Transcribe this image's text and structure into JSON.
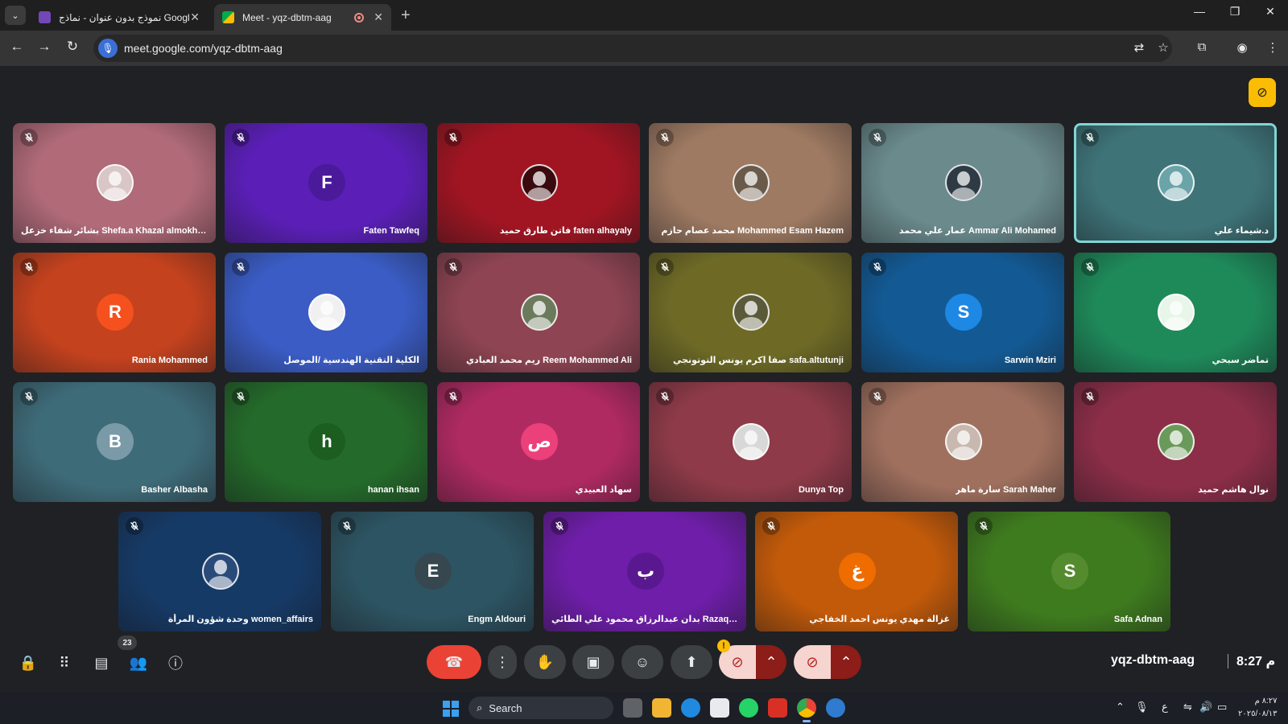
{
  "browser": {
    "tabs": [
      {
        "title": "نموذج بدون عنوان - نماذج Google",
        "active": false
      },
      {
        "title": "Meet - yqz-dbtm-aag",
        "active": true
      }
    ],
    "url": "meet.google.com/yqz-dbtm-aag"
  },
  "meet": {
    "participants": [
      {
        "name": "بشائر شفاء خزعل Shefa.a Khazal almokhtar ...",
        "initial": "",
        "bg": "#b06a78",
        "avatar_color": "#d9c6c6",
        "photo": true
      },
      {
        "name": "Faten Tawfeq",
        "initial": "F",
        "bg": "#5b1fb8",
        "avatar_color": "#4a1a9a",
        "photo": false
      },
      {
        "name": "فاتن طارق حميد faten alhayaly",
        "initial": "",
        "bg": "#a11522",
        "avatar_color": "#3a0a0e",
        "photo": true
      },
      {
        "name": "محمد عصام حازم Mohammed Esam Hazem",
        "initial": "",
        "bg": "#9e7a62",
        "avatar_color": "#6a5a4a",
        "photo": true
      },
      {
        "name": "عمار علي محمد Ammar Ali Mohamed",
        "initial": "",
        "bg": "#6a8a8c",
        "avatar_color": "#2e3a44",
        "photo": true
      },
      {
        "name": "د.شيماء علي",
        "initial": "",
        "bg": "#3e7478",
        "avatar_color": "#6aa4a8",
        "photo": true
      },
      {
        "name": "Rania Mohammed",
        "initial": "R",
        "bg": "#c4421e",
        "avatar_color": "#f4511e",
        "photo": false
      },
      {
        "name": "الكلية التقنية الهندسية /الموصل",
        "initial": "",
        "bg": "#3a5cc4",
        "avatar_color": "#f0f0f0",
        "photo": true
      },
      {
        "name": "ريم محمد العبادي Reem Mohammed Ali",
        "initial": "",
        "bg": "#8e4452",
        "avatar_color": "#6a7a5a",
        "photo": true
      },
      {
        "name": "صفا اكرم يونس التوتونجي safa.altutunji",
        "initial": "",
        "bg": "#6e6a26",
        "avatar_color": "#5a5a3a",
        "photo": true
      },
      {
        "name": "Sarwin Mziri",
        "initial": "S",
        "bg": "#135a94",
        "avatar_color": "#1e88e5",
        "photo": false
      },
      {
        "name": "تماضر سبحي",
        "initial": "",
        "bg": "#1e8a5a",
        "avatar_color": "#e8f5e9",
        "photo": true
      },
      {
        "name": "Basher Albasha",
        "initial": "B",
        "bg": "#3e6b78",
        "avatar_color": "#7b9aa8",
        "photo": false
      },
      {
        "name": "hanan ihsan",
        "initial": "h",
        "bg": "#246a2a",
        "avatar_color": "#1b5e20",
        "photo": false
      },
      {
        "name": "سهاد العبيدي",
        "initial": "ص",
        "bg": "#b02a62",
        "avatar_color": "#ec407a",
        "photo": false
      },
      {
        "name": "Dunya Top",
        "initial": "",
        "bg": "#8e3a48",
        "avatar_color": "#d8d8d8",
        "photo": true
      },
      {
        "name": "سارة ماهر Sarah Maher",
        "initial": "",
        "bg": "#a0705e",
        "avatar_color": "#c8b8b0",
        "photo": true
      },
      {
        "name": "نوال هاشم حميد",
        "initial": "",
        "bg": "#8c2e48",
        "avatar_color": "#6a9a5a",
        "photo": true
      },
      {
        "name": "وحدة شؤون المرأة women_affairs",
        "initial": "",
        "bg": "#163a66",
        "avatar_color": "#2a4a7a",
        "photo": true
      },
      {
        "name": "Engm Aldouri",
        "initial": "E",
        "bg": "#2d5462",
        "avatar_color": "#37474f",
        "photo": false
      },
      {
        "name": "بدان عبدالرزاق محمود علي الطائي Razaq Mahmood...",
        "initial": "ب",
        "bg": "#6e1ea8",
        "avatar_color": "#5a1890",
        "photo": false
      },
      {
        "name": "غزالة مهدي يونس احمد الخفاجي",
        "initial": "غ",
        "bg": "#c25a0a",
        "avatar_color": "#ef6c00",
        "photo": false
      },
      {
        "name": "Safa Adnan",
        "initial": "S",
        "bg": "#3e7a1e",
        "avatar_color": "#558b2f",
        "photo": false
      }
    ],
    "people_count": "23",
    "meeting_code": "yqz-dbtm-aag",
    "time": "8:27 م"
  },
  "taskbar": {
    "search_placeholder": "Search",
    "clock_time": "٨:٢٧ م",
    "clock_date": "٢٠٢٥/٠٨/١٣",
    "lang": "ع"
  },
  "colors": {
    "end_call": "#ea4335",
    "warning": "#fbbc04"
  }
}
